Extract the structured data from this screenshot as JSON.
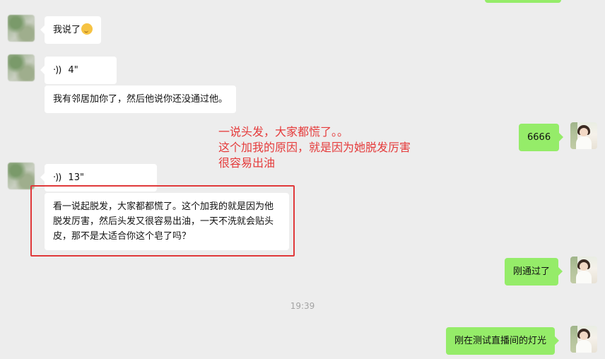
{
  "chat": {
    "msg1": {
      "text": "我说了",
      "emoji": "thinking-emoji"
    },
    "voice1": {
      "duration": "4\""
    },
    "msg2": {
      "text": "我有邻居加你了，然后他说你还没通过他。"
    },
    "self1": {
      "text": "6666"
    },
    "voice2": {
      "duration": "13\""
    },
    "msg3": {
      "text": "看一说起脱发，大家都都慌了。这个加我的就是因为他脱发厉害，然后头发又很容易出油，一天不洗就会贴头皮，那不是太适合你这个皂了吗？"
    },
    "self2": {
      "text": "刚通过了"
    },
    "timestamp": "19:39",
    "self3": {
      "text": "刚在测试直播间的灯光"
    }
  },
  "annotation": {
    "line1": "一说头发，大家都慌了。。",
    "line2": "这个加我的原因，就是因为她脱发厉害",
    "line3": "很容易出油"
  },
  "colors": {
    "background": "#ededed",
    "incoming_bubble": "#ffffff",
    "outgoing_bubble": "#95ec69",
    "annotation": "#e53b3b",
    "highlight_box": "#e0393a"
  }
}
